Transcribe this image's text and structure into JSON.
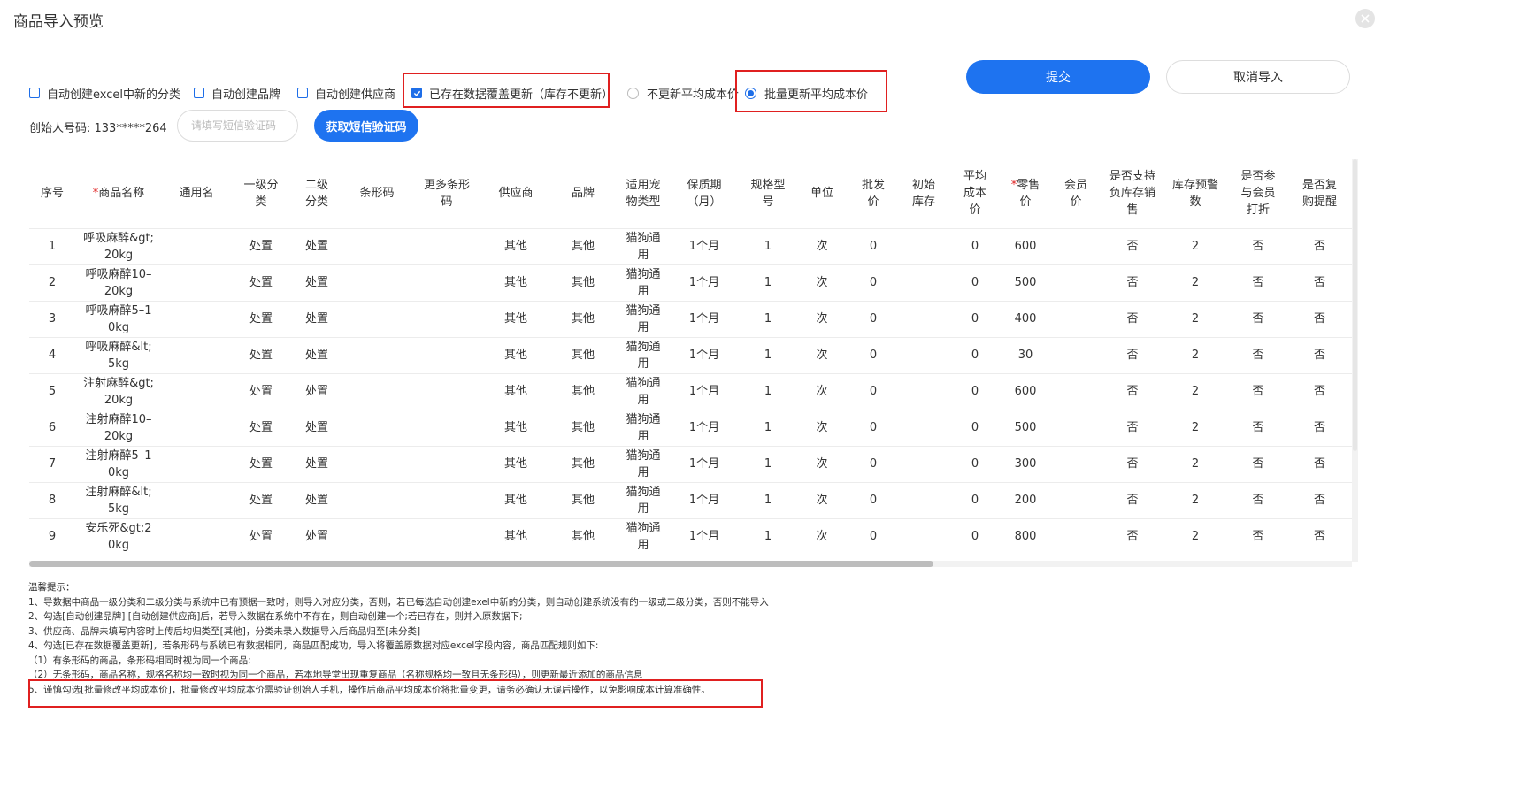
{
  "dialog": {
    "title": "商品导入预览"
  },
  "options": {
    "auto_category": "自动创建excel中新的分类",
    "auto_brand": "自动创建品牌",
    "auto_supplier": "自动创建供应商",
    "overwrite_existing": "已存在数据覆盖更新（库存不更新）",
    "no_update_avg_cost": "不更新平均成本价",
    "batch_update_avg_cost": "批量更新平均成本价"
  },
  "actions": {
    "submit": "提交",
    "cancel": "取消导入",
    "get_sms": "获取短信验证码"
  },
  "creator": {
    "label": "创始人号码: 133*****264",
    "sms_placeholder": "请填写短信验证码"
  },
  "colors": {
    "primary": "#1e73f0",
    "highlight_border": "#e02020"
  },
  "table": {
    "headers": [
      {
        "text": "序号",
        "req": ""
      },
      {
        "text": "商品名称",
        "req": "*"
      },
      {
        "text": "通用名",
        "req": ""
      },
      {
        "text": "一级分\n类",
        "req": ""
      },
      {
        "text": "二级\n分类",
        "req": ""
      },
      {
        "text": "条形码",
        "req": ""
      },
      {
        "text": "更多条形\n码",
        "req": ""
      },
      {
        "text": "供应商",
        "req": ""
      },
      {
        "text": "品牌",
        "req": ""
      },
      {
        "text": "适用宠\n物类型",
        "req": ""
      },
      {
        "text": "保质期\n（月）",
        "req": ""
      },
      {
        "text": "规格型\n号",
        "req": ""
      },
      {
        "text": "单位",
        "req": ""
      },
      {
        "text": "批发\n价",
        "req": ""
      },
      {
        "text": "初始\n库存",
        "req": ""
      },
      {
        "text": "平均\n成本\n价",
        "req": ""
      },
      {
        "text": "零售\n价",
        "req": "*"
      },
      {
        "text": "会员\n价",
        "req": ""
      },
      {
        "text": "是否支持\n负库存销\n售",
        "req": ""
      },
      {
        "text": "库存预警\n数",
        "req": ""
      },
      {
        "text": "是否参\n与会员\n打折",
        "req": ""
      },
      {
        "text": "是否复\n购提醒",
        "req": ""
      }
    ],
    "rows": [
      [
        "1",
        "呼吸麻醉&gt;\n20kg",
        "",
        "处置",
        "处置",
        "",
        "",
        "其他",
        "其他",
        "猫狗通\n用",
        "1个月",
        "1",
        "次",
        "0",
        "",
        "0",
        "600",
        "",
        "否",
        "2",
        "否",
        "否"
      ],
      [
        "2",
        "呼吸麻醉10–\n20kg",
        "",
        "处置",
        "处置",
        "",
        "",
        "其他",
        "其他",
        "猫狗通\n用",
        "1个月",
        "1",
        "次",
        "0",
        "",
        "0",
        "500",
        "",
        "否",
        "2",
        "否",
        "否"
      ],
      [
        "3",
        "呼吸麻醉5–1\n0kg",
        "",
        "处置",
        "处置",
        "",
        "",
        "其他",
        "其他",
        "猫狗通\n用",
        "1个月",
        "1",
        "次",
        "0",
        "",
        "0",
        "400",
        "",
        "否",
        "2",
        "否",
        "否"
      ],
      [
        "4",
        "呼吸麻醉&lt;\n5kg",
        "",
        "处置",
        "处置",
        "",
        "",
        "其他",
        "其他",
        "猫狗通\n用",
        "1个月",
        "1",
        "次",
        "0",
        "",
        "0",
        "30",
        "",
        "否",
        "2",
        "否",
        "否"
      ],
      [
        "5",
        "注射麻醉&gt;\n20kg",
        "",
        "处置",
        "处置",
        "",
        "",
        "其他",
        "其他",
        "猫狗通\n用",
        "1个月",
        "1",
        "次",
        "0",
        "",
        "0",
        "600",
        "",
        "否",
        "2",
        "否",
        "否"
      ],
      [
        "6",
        "注射麻醉10–\n20kg",
        "",
        "处置",
        "处置",
        "",
        "",
        "其他",
        "其他",
        "猫狗通\n用",
        "1个月",
        "1",
        "次",
        "0",
        "",
        "0",
        "500",
        "",
        "否",
        "2",
        "否",
        "否"
      ],
      [
        "7",
        "注射麻醉5–1\n0kg",
        "",
        "处置",
        "处置",
        "",
        "",
        "其他",
        "其他",
        "猫狗通\n用",
        "1个月",
        "1",
        "次",
        "0",
        "",
        "0",
        "300",
        "",
        "否",
        "2",
        "否",
        "否"
      ],
      [
        "8",
        "注射麻醉&lt;\n5kg",
        "",
        "处置",
        "处置",
        "",
        "",
        "其他",
        "其他",
        "猫狗通\n用",
        "1个月",
        "1",
        "次",
        "0",
        "",
        "0",
        "200",
        "",
        "否",
        "2",
        "否",
        "否"
      ],
      [
        "9",
        "安乐死&gt;2\n0kg",
        "",
        "处置",
        "处置",
        "",
        "",
        "其他",
        "其他",
        "猫狗通\n用",
        "1个月",
        "1",
        "次",
        "0",
        "",
        "0",
        "800",
        "",
        "否",
        "2",
        "否",
        "否"
      ]
    ]
  },
  "tips": {
    "lines": [
      "温馨提示：",
      "1、导数据中商品一级分类和二级分类与系统中已有预据一致时，则导入对应分类，否则，若已每选自动创建exel中新的分类，则自动创建系统没有的一级或二级分类，否则不能导入",
      "2、勾选[自动创建品牌] [自动创建供应商]后，若导入数据在系统中不存在，则自动创建一个;若已存在，则并入原数据下;",
      "3、供应商、品牌未填写内容时上传后均归类至[其他]，分类未录入数据导入后商品归至[未分类]",
      "4、勾选[已存在数据覆盖更新]，若条形码与系统已有数据相同，商品匹配成功，导入将覆盖原数据对应excel字段内容，商品匹配规则如下:",
      "（1）有条形码的商品，条形码相同时视为同一个商品;",
      "（2）无条形码，商品名称，规格名称均一致时视为同一个商品，若本地导堂出现重复商品（名称规格均一致且无条形码），则更新最近添加的商品信息",
      "5、谨慎勾选[批量修改平均成本价]，批量修改平均成本价需验证创始人手机，操作后商品平均成本价将批量变更，请务必确认无误后操作，以免影响成本计算准确性。"
    ]
  }
}
